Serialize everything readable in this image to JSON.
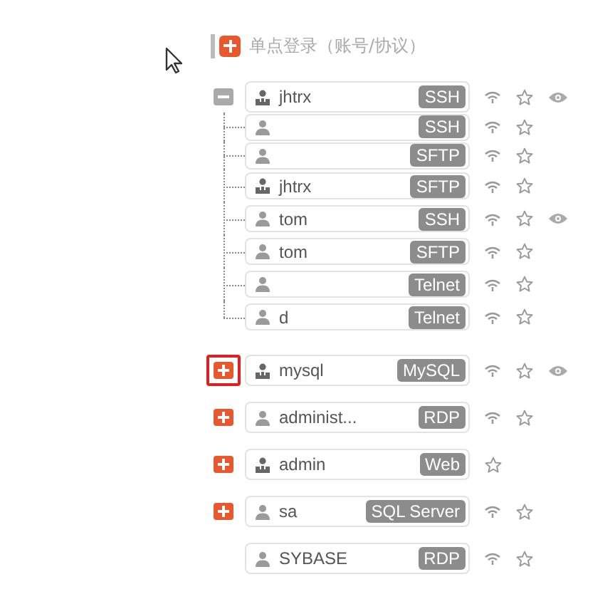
{
  "header": {
    "title": "单点登录（账号/协议）"
  },
  "accounts": [
    {
      "name": "jhtrx",
      "protocol": "SSH",
      "kind": "shared",
      "expanded": true,
      "highlighted": false,
      "connect": true,
      "watch": true,
      "children": [
        {
          "protocol": "SSH",
          "kind": "user",
          "connect": true,
          "watch": false
        },
        {
          "protocol": "SFTP",
          "kind": "user",
          "connect": true,
          "watch": false
        },
        {
          "name": "jhtrx",
          "protocol": "SFTP",
          "kind": "shared",
          "connect": true,
          "watch": false
        },
        {
          "name": "tom",
          "protocol": "SSH",
          "kind": "user",
          "connect": true,
          "watch": true
        },
        {
          "name": "tom",
          "protocol": "SFTP",
          "kind": "user",
          "connect": true,
          "watch": false
        },
        {
          "protocol": "Telnet",
          "kind": "user",
          "connect": true,
          "watch": false
        },
        {
          "name": "d",
          "protocol": "Telnet",
          "kind": "user",
          "connect": true,
          "watch": false
        }
      ]
    },
    {
      "name": "mysql",
      "protocol": "MySQL",
      "kind": "shared",
      "expanded": false,
      "highlighted": true,
      "connect": true,
      "watch": true
    },
    {
      "name": "administ...",
      "protocol": "RDP",
      "kind": "user",
      "expanded": false,
      "highlighted": false,
      "connect": true,
      "watch": false
    },
    {
      "name": "admin",
      "protocol": "Web",
      "kind": "shared",
      "expanded": false,
      "highlighted": false,
      "connect": false,
      "watch": false
    },
    {
      "name": "sa",
      "protocol": "SQL Server",
      "kind": "user",
      "expanded": false,
      "highlighted": false,
      "connect": true,
      "watch": false
    },
    {
      "name": "SYBASE",
      "protocol": "RDP",
      "kind": "user",
      "connect": true,
      "watch": false
    }
  ]
}
